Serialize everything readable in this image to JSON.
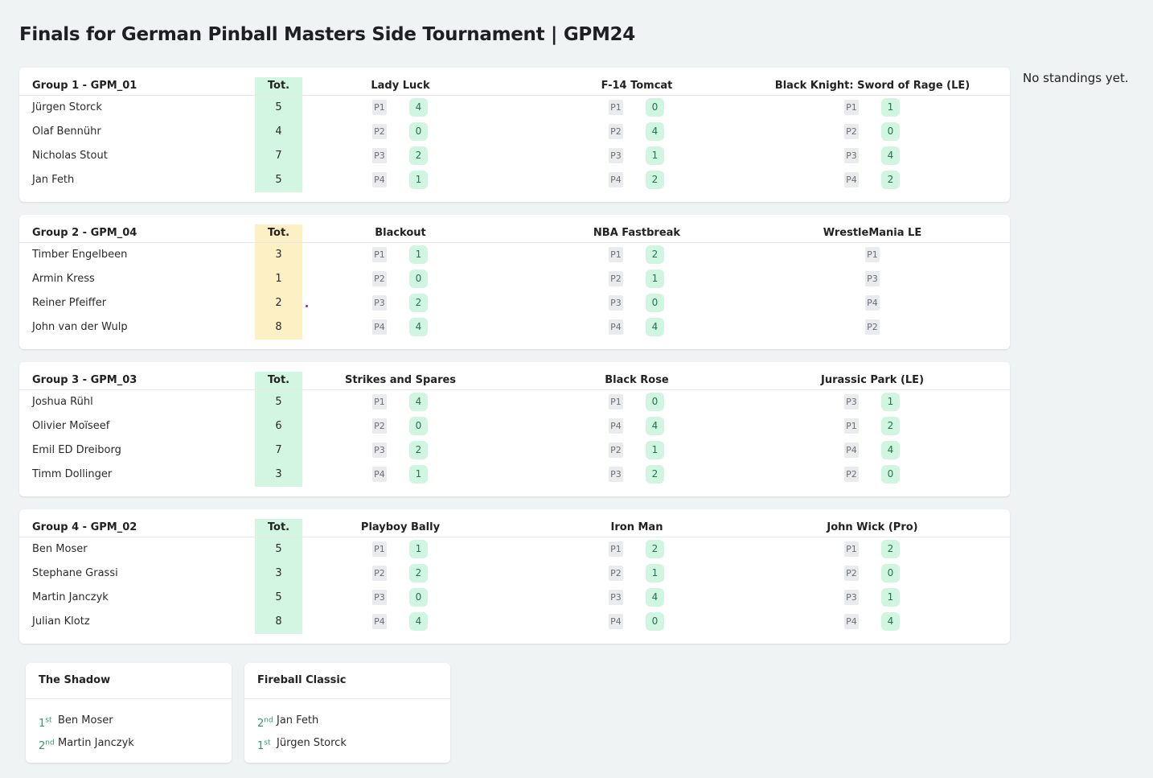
{
  "page": {
    "title": "Finals for German Pinball Masters Side Tournament | GPM24",
    "standings_note": "No standings yet."
  },
  "colors": {
    "accent_green": "#d2f6e2",
    "accent_yellow": "#fdf0c4",
    "points_text": "#23734c",
    "place_text": "#2f9a62"
  },
  "groups": [
    {
      "title": "Group 1 - GPM_01",
      "tot_label": "Tot.",
      "tot_highlight": "green",
      "games": [
        "Lady Luck",
        "F-14 Tomcat",
        "Black Knight: Sword of Rage (LE)"
      ],
      "rows": [
        {
          "name": "Jürgen Storck",
          "total": "5",
          "results": [
            {
              "pos": "P1",
              "pts": "4"
            },
            {
              "pos": "P1",
              "pts": "0"
            },
            {
              "pos": "P1",
              "pts": "1"
            }
          ]
        },
        {
          "name": "Olaf Bennühr",
          "total": "4",
          "results": [
            {
              "pos": "P2",
              "pts": "0"
            },
            {
              "pos": "P2",
              "pts": "4"
            },
            {
              "pos": "P2",
              "pts": "0"
            }
          ]
        },
        {
          "name": "Nicholas Stout",
          "total": "7",
          "results": [
            {
              "pos": "P3",
              "pts": "2"
            },
            {
              "pos": "P3",
              "pts": "1"
            },
            {
              "pos": "P3",
              "pts": "4"
            }
          ]
        },
        {
          "name": "Jan Feth",
          "total": "5",
          "results": [
            {
              "pos": "P4",
              "pts": "1"
            },
            {
              "pos": "P4",
              "pts": "2"
            },
            {
              "pos": "P4",
              "pts": "2"
            }
          ]
        }
      ]
    },
    {
      "title": "Group 2 - GPM_04",
      "tot_label": "Tot.",
      "tot_highlight": "yellow",
      "games": [
        "Blackout",
        "NBA Fastbreak",
        "WrestleMania LE"
      ],
      "rows": [
        {
          "name": "Timber Engelbeen",
          "total": "3",
          "results": [
            {
              "pos": "P1",
              "pts": "1"
            },
            {
              "pos": "P1",
              "pts": "2"
            },
            {
              "pos": "P1",
              "pts": ""
            }
          ]
        },
        {
          "name": "Armin Kress",
          "total": "1",
          "results": [
            {
              "pos": "P2",
              "pts": "0"
            },
            {
              "pos": "P2",
              "pts": "1"
            },
            {
              "pos": "P3",
              "pts": ""
            }
          ]
        },
        {
          "name": "Reiner Pfeiffer",
          "total": "2",
          "results": [
            {
              "pos": "P3",
              "pts": "2"
            },
            {
              "pos": "P3",
              "pts": "0"
            },
            {
              "pos": "P4",
              "pts": ""
            }
          ]
        },
        {
          "name": "John van der Wulp",
          "total": "8",
          "results": [
            {
              "pos": "P4",
              "pts": "4"
            },
            {
              "pos": "P4",
              "pts": "4"
            },
            {
              "pos": "P2",
              "pts": ""
            }
          ]
        }
      ]
    },
    {
      "title": "Group 3 - GPM_03",
      "tot_label": "Tot.",
      "tot_highlight": "green",
      "games": [
        "Strikes and Spares",
        "Black Rose",
        "Jurassic Park (LE)"
      ],
      "rows": [
        {
          "name": "Joshua Rühl",
          "total": "5",
          "results": [
            {
              "pos": "P1",
              "pts": "4"
            },
            {
              "pos": "P1",
              "pts": "0"
            },
            {
              "pos": "P3",
              "pts": "1"
            }
          ]
        },
        {
          "name": "Olivier Moïseef",
          "total": "6",
          "results": [
            {
              "pos": "P2",
              "pts": "0"
            },
            {
              "pos": "P4",
              "pts": "4"
            },
            {
              "pos": "P1",
              "pts": "2"
            }
          ]
        },
        {
          "name": "Emil ED Dreiborg",
          "total": "7",
          "results": [
            {
              "pos": "P3",
              "pts": "2"
            },
            {
              "pos": "P2",
              "pts": "1"
            },
            {
              "pos": "P4",
              "pts": "4"
            }
          ]
        },
        {
          "name": "Timm Dollinger",
          "total": "3",
          "results": [
            {
              "pos": "P4",
              "pts": "1"
            },
            {
              "pos": "P3",
              "pts": "2"
            },
            {
              "pos": "P2",
              "pts": "0"
            }
          ]
        }
      ]
    },
    {
      "title": "Group 4 - GPM_02",
      "tot_label": "Tot.",
      "tot_highlight": "green",
      "games": [
        "Playboy Bally",
        "Iron Man",
        "John Wick (Pro)"
      ],
      "rows": [
        {
          "name": "Ben Moser",
          "total": "5",
          "results": [
            {
              "pos": "P1",
              "pts": "1"
            },
            {
              "pos": "P1",
              "pts": "2"
            },
            {
              "pos": "P1",
              "pts": "2"
            }
          ]
        },
        {
          "name": "Stephane Grassi",
          "total": "3",
          "results": [
            {
              "pos": "P2",
              "pts": "2"
            },
            {
              "pos": "P2",
              "pts": "1"
            },
            {
              "pos": "P2",
              "pts": "0"
            }
          ]
        },
        {
          "name": "Martin Janczyk",
          "total": "5",
          "results": [
            {
              "pos": "P3",
              "pts": "0"
            },
            {
              "pos": "P3",
              "pts": "4"
            },
            {
              "pos": "P3",
              "pts": "1"
            }
          ]
        },
        {
          "name": "Julian Klotz",
          "total": "8",
          "results": [
            {
              "pos": "P4",
              "pts": "4"
            },
            {
              "pos": "P4",
              "pts": "0"
            },
            {
              "pos": "P4",
              "pts": "4"
            }
          ]
        }
      ]
    }
  ],
  "finals": [
    {
      "title": "The Shadow",
      "entries": [
        {
          "place": "1",
          "suffix": "st",
          "name": "Ben Moser"
        },
        {
          "place": "2",
          "suffix": "nd",
          "name": "Martin Janczyk"
        }
      ]
    },
    {
      "title": "Fireball Classic",
      "entries": [
        {
          "place": "2",
          "suffix": "nd",
          "name": "Jan Feth"
        },
        {
          "place": "1",
          "suffix": "st",
          "name": "Jürgen Storck"
        }
      ]
    }
  ]
}
